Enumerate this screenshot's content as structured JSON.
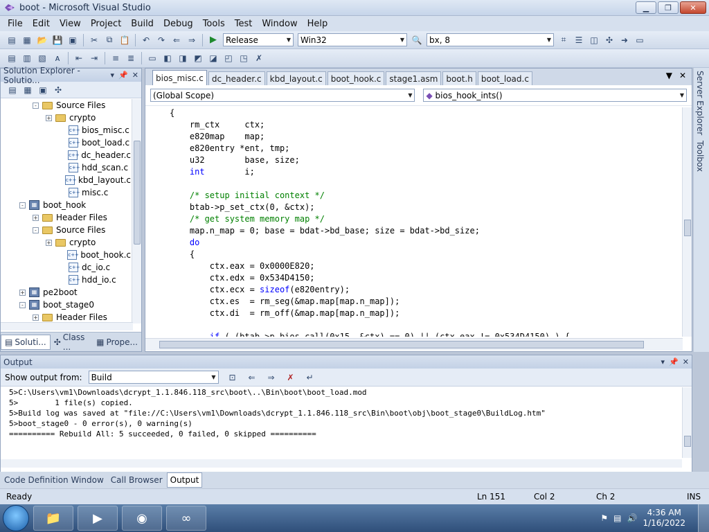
{
  "window": {
    "title": "boot - Microsoft Visual Studio"
  },
  "menu": [
    "File",
    "Edit",
    "View",
    "Project",
    "Build",
    "Debug",
    "Tools",
    "Test",
    "Window",
    "Help"
  ],
  "toolbar": {
    "config": "Release",
    "platform": "Win32",
    "find": "bx, 8"
  },
  "solution_explorer": {
    "title": "Solution Explorer - Solutio...",
    "tree": [
      {
        "label": "Source Files",
        "kind": "folder",
        "indent": 2,
        "exp": "-"
      },
      {
        "label": "crypto",
        "kind": "folder",
        "indent": 3,
        "exp": "+"
      },
      {
        "label": "bios_misc.c",
        "kind": "file",
        "indent": 4
      },
      {
        "label": "boot_load.c",
        "kind": "file",
        "indent": 4
      },
      {
        "label": "dc_header.c",
        "kind": "file",
        "indent": 4
      },
      {
        "label": "hdd_scan.c",
        "kind": "file",
        "indent": 4
      },
      {
        "label": "kbd_layout.c",
        "kind": "file",
        "indent": 4
      },
      {
        "label": "misc.c",
        "kind": "file",
        "indent": 4
      },
      {
        "label": "boot_hook",
        "kind": "project",
        "indent": 1,
        "exp": "-"
      },
      {
        "label": "Header Files",
        "kind": "folder",
        "indent": 2,
        "exp": "+"
      },
      {
        "label": "Source Files",
        "kind": "folder",
        "indent": 2,
        "exp": "-"
      },
      {
        "label": "crypto",
        "kind": "folder",
        "indent": 3,
        "exp": "+"
      },
      {
        "label": "boot_hook.c",
        "kind": "file",
        "indent": 4
      },
      {
        "label": "dc_io.c",
        "kind": "file",
        "indent": 4
      },
      {
        "label": "hdd_io.c",
        "kind": "file",
        "indent": 4
      },
      {
        "label": "pe2boot",
        "kind": "project",
        "indent": 1,
        "exp": "+"
      },
      {
        "label": "boot_stage0",
        "kind": "project",
        "indent": 1,
        "exp": "-"
      },
      {
        "label": "Header Files",
        "kind": "folder",
        "indent": 2,
        "exp": "+"
      }
    ],
    "tabs": [
      "Soluti...",
      "Class ...",
      "Prope..."
    ]
  },
  "editor": {
    "tabs": [
      "bios_misc.c",
      "dc_header.c",
      "kbd_layout.c",
      "boot_hook.c",
      "stage1.asm",
      "boot.h",
      "boot_load.c"
    ],
    "scope": "(Global Scope)",
    "function": "bios_hook_ints()",
    "code": [
      {
        "t": "{"
      },
      {
        "t": "    rm_ctx     ctx;"
      },
      {
        "t": "    e820map    map;"
      },
      {
        "t": "    e820entry *ent, tmp;"
      },
      {
        "t": "    u32        base, size;"
      },
      {
        "t": "    int        i;",
        "kw": "int"
      },
      {
        "t": ""
      },
      {
        "t": "    /* setup initial context */",
        "cls": "cm"
      },
      {
        "t": "    btab->p_set_ctx(0, &ctx);"
      },
      {
        "t": "    /* get system memory map */",
        "cls": "cm"
      },
      {
        "t": "    map.n_map = 0; base = bdat->bd_base; size = bdat->bd_size;"
      },
      {
        "t": "    do",
        "cls": "kw"
      },
      {
        "t": "    {"
      },
      {
        "t": "        ctx.eax = 0x0000E820;"
      },
      {
        "t": "        ctx.edx = 0x534D4150;"
      },
      {
        "t": "        ctx.ecx = sizeof(e820entry);",
        "kw": "sizeof"
      },
      {
        "t": "        ctx.es  = rm_seg(&map.map[map.n_map]);"
      },
      {
        "t": "        ctx.di  = rm_off(&map.map[map.n_map]);"
      },
      {
        "t": ""
      },
      {
        "t": "        if ( (btab->p_bios_call(0x15, &ctx) == 0) || (ctx.eax != 0x534D4150) ) {",
        "kw": "if"
      }
    ]
  },
  "right_rail": [
    "Server Explorer",
    "Toolbox"
  ],
  "output": {
    "title": "Output",
    "show_from_label": "Show output from:",
    "show_from_value": "Build",
    "lines": [
      "5>C:\\Users\\vm1\\Downloads\\dcrypt_1.1.846.118_src\\boot\\..\\Bin\\boot\\boot_load.mod",
      "5>        1 file(s) copied.",
      "5>Build log was saved at \"file://C:\\Users\\vm1\\Downloads\\dcrypt_1.1.846.118_src\\Bin\\boot\\obj\\boot_stage0\\BuildLog.htm\"",
      "5>boot_stage0 - 0 error(s), 0 warning(s)",
      "========== Rebuild All: 5 succeeded, 0 failed, 0 skipped =========="
    ]
  },
  "bottom_tabs": [
    "Code Definition Window",
    "Call Browser",
    "Output"
  ],
  "status": {
    "ready": "Ready",
    "ln": "Ln 151",
    "col": "Col 2",
    "ch": "Ch 2",
    "ins": "INS"
  },
  "taskbar": {
    "time": "4:36 AM",
    "date": "1/16/2022"
  }
}
